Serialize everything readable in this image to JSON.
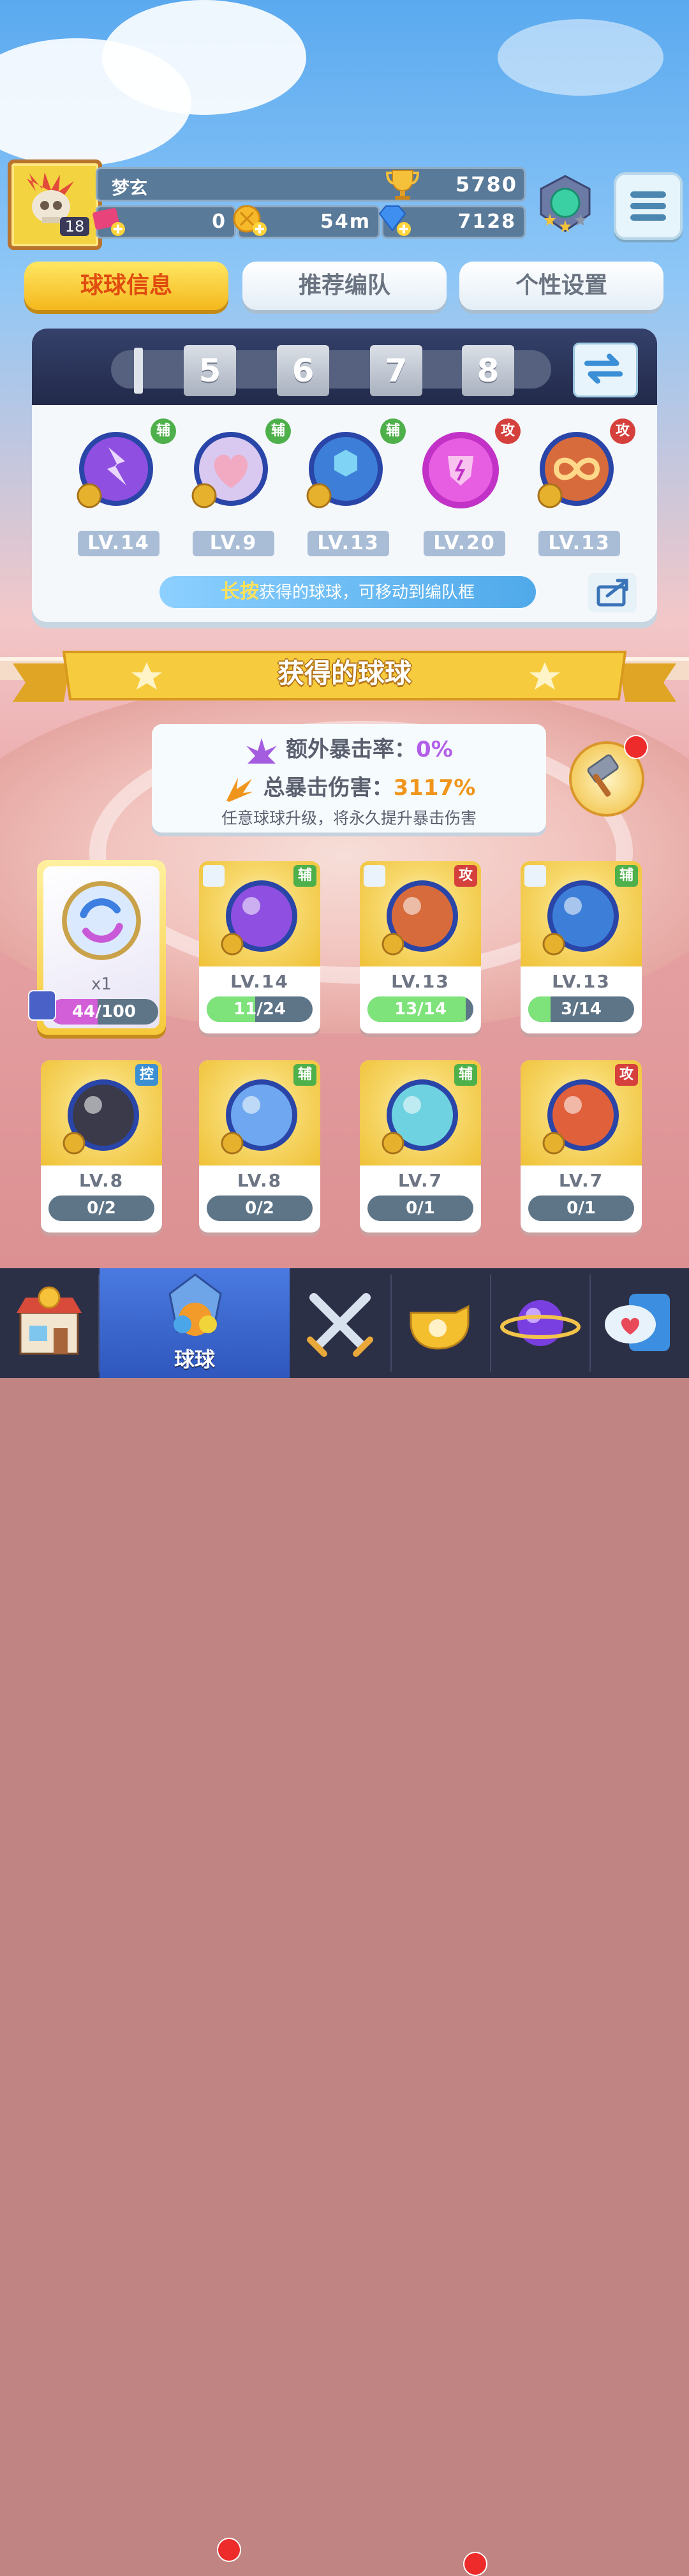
{
  "player": {
    "name": "梦玄",
    "level": "18",
    "trophies": "5780",
    "ticket_count": "0",
    "coin_timer": "54m",
    "gems": "7128"
  },
  "tabs": [
    {
      "label": "球球信息",
      "active": true
    },
    {
      "label": "推荐编队",
      "active": false
    },
    {
      "label": "个性设置",
      "active": false
    }
  ],
  "formation": {
    "slots": [
      "5",
      "6",
      "7",
      "8"
    ],
    "balls": [
      {
        "level": "LV.14",
        "role": "辅",
        "role_color": "#4eb04a",
        "icon": "lightning-orb-icon"
      },
      {
        "level": "LV.9",
        "role": "辅",
        "role_color": "#4eb04a",
        "icon": "heart-orb-icon"
      },
      {
        "level": "LV.13",
        "role": "辅",
        "role_color": "#4eb04a",
        "icon": "hexagon-orb-icon"
      },
      {
        "level": "LV.20",
        "role": "攻",
        "role_color": "#d5403c",
        "icon": "shield-crack-orb-icon"
      },
      {
        "level": "LV.13",
        "role": "攻",
        "role_color": "#d5403c",
        "icon": "infinity-orb-icon"
      }
    ],
    "hint_highlight": "长按",
    "hint_text": "获得的球球，可移动到编队框"
  },
  "obtained": {
    "title": "获得的球球",
    "crit_rate_label": "额外暴击率：",
    "crit_rate_value": "0%",
    "crit_damage_label": "总暴击伤害：",
    "crit_damage_value": "3117%",
    "note": "任意球球升级，将永久提升暴击伤害"
  },
  "featured": {
    "count": "x1",
    "progress_text": "44/100",
    "progress": 0.44
  },
  "cards": [
    {
      "level": "LV.14",
      "role": "辅",
      "progress_text": "11/24",
      "progress": 0.46,
      "pinned": true,
      "icon": "lightning-orb-icon"
    },
    {
      "level": "LV.13",
      "role": "攻",
      "progress_text": "13/14",
      "progress": 0.93,
      "pinned": true,
      "icon": "infinity-orb-icon"
    },
    {
      "level": "LV.13",
      "role": "辅",
      "progress_text": "3/14",
      "progress": 0.21,
      "pinned": true,
      "icon": "hexagon-orb-icon"
    },
    {
      "level": "LV.8",
      "role": "控",
      "progress_text": "0/2",
      "progress": 0,
      "pinned": false,
      "icon": "demon-orb-icon"
    },
    {
      "level": "LV.8",
      "role": "辅",
      "progress_text": "0/2",
      "progress": 0,
      "pinned": false,
      "icon": "ribbon-orb-icon"
    },
    {
      "level": "LV.7",
      "role": "辅",
      "progress_text": "0/1",
      "progress": 0,
      "pinned": false,
      "icon": "swirl-orb-icon"
    },
    {
      "level": "LV.7",
      "role": "攻",
      "progress_text": "0/1",
      "progress": 0,
      "pinned": false,
      "icon": "burst-orb-icon"
    }
  ],
  "nav": [
    {
      "icon": "shop-icon",
      "label": ""
    },
    {
      "icon": "ball-icon",
      "label": "球球",
      "active": true
    },
    {
      "icon": "crossed-swords-icon",
      "label": ""
    },
    {
      "icon": "whistle-icon",
      "label": ""
    },
    {
      "icon": "planet-icon",
      "label": ""
    },
    {
      "icon": "chat-heart-icon",
      "label": ""
    }
  ]
}
